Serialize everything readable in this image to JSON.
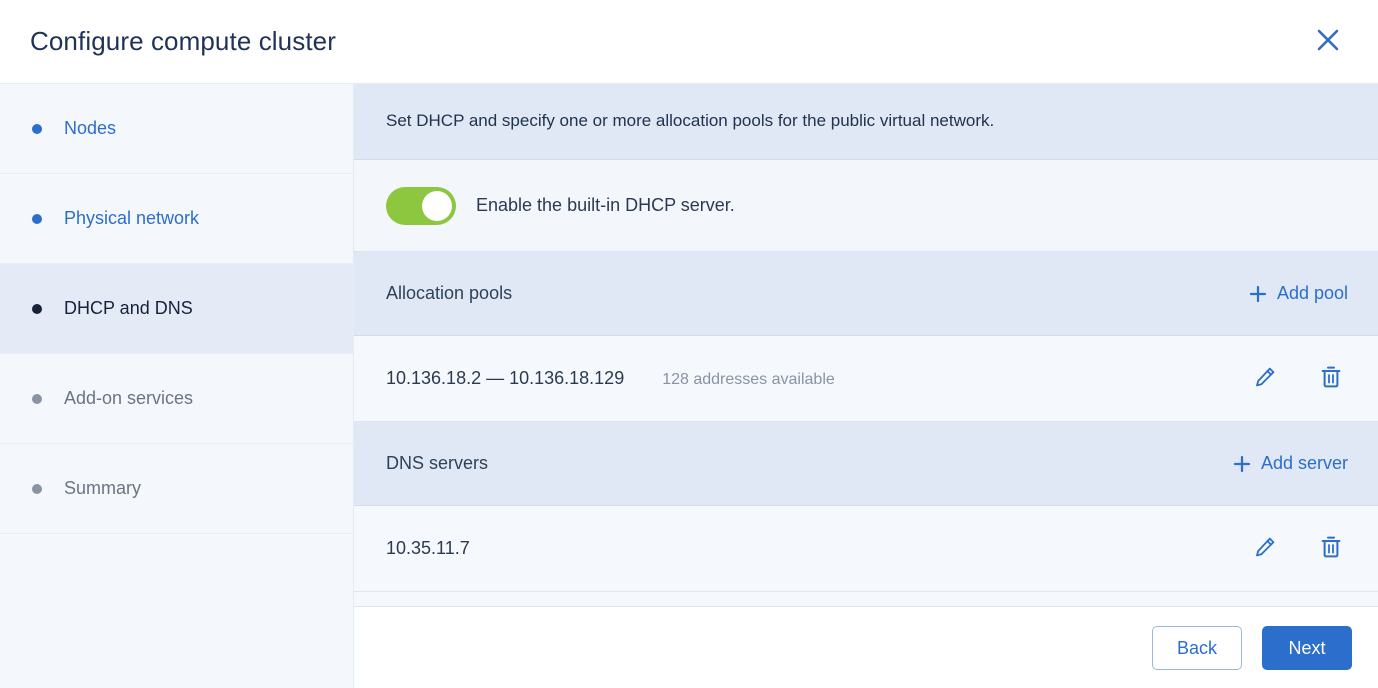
{
  "header": {
    "title": "Configure compute cluster",
    "close_icon": "close-icon"
  },
  "sidebar": {
    "items": [
      {
        "label": "Nodes",
        "state": "done"
      },
      {
        "label": "Physical network",
        "state": "done"
      },
      {
        "label": "DHCP and DNS",
        "state": "active"
      },
      {
        "label": "Add-on services",
        "state": "pending"
      },
      {
        "label": "Summary",
        "state": "pending"
      }
    ]
  },
  "main": {
    "banner": "Set DHCP and specify one or more allocation pools for the public virtual network.",
    "dhcp_toggle": {
      "label": "Enable the built-in DHCP server.",
      "enabled": true
    },
    "sections": [
      {
        "title": "Allocation pools",
        "add_label": "Add pool",
        "rows": [
          {
            "primary": "10.136.18.2 — 10.136.18.129",
            "secondary": "128 addresses available"
          }
        ]
      },
      {
        "title": "DNS servers",
        "add_label": "Add server",
        "rows": [
          {
            "primary": "10.35.11.7",
            "secondary": ""
          }
        ]
      }
    ],
    "row_actions": {
      "edit_icon": "pencil-icon",
      "delete_icon": "trash-icon"
    }
  },
  "footer": {
    "back_label": "Back",
    "next_label": "Next"
  },
  "colors": {
    "accent": "#2c6ecb",
    "title": "#1f3356",
    "toggle_on": "#8dc63f",
    "banner_bg": "#dfe8f4",
    "row_bg": "#f5f8fd",
    "sidebar_bg": "#f4f7fc",
    "sidebar_active_bg": "#e5ebf6",
    "muted_text": "#8a93a3"
  }
}
